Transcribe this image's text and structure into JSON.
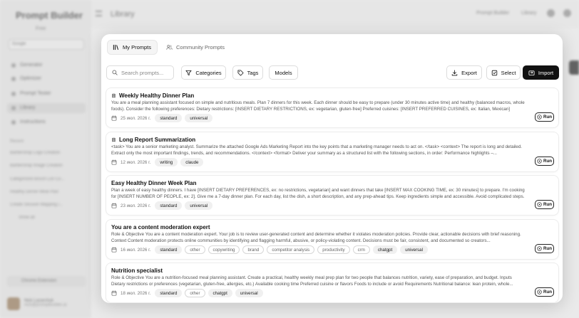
{
  "background": {
    "brand": "Prompt Builder",
    "plan": "Free",
    "workspace_select": "Google",
    "nav": [
      {
        "label": "Generator"
      },
      {
        "label": "Optimizer"
      },
      {
        "label": "Prompt Tester"
      },
      {
        "label": "Library"
      },
      {
        "label": "Instructions"
      }
    ],
    "recent_heading": "Recent",
    "recent": [
      "Barbershop Logo Creation",
      "Barbershop Image Creation",
      "Categorized Bosch List Co...",
      "Healthy Dinner Meal Plan",
      "Create Session Mapping i..."
    ],
    "recent_more": "Show all",
    "extension": "Chrome Extension",
    "user_name": "Nick Lazarchuk",
    "user_email": "nick@promptbuilder.ai",
    "page_title": "Library",
    "top_links": [
      "Prompt Builder",
      "Library"
    ]
  },
  "modal": {
    "tabs": [
      {
        "label": "My Prompts",
        "icon": "library-icon",
        "active": true
      },
      {
        "label": "Community Prompts",
        "icon": "users-icon",
        "active": false
      }
    ],
    "toolbar": {
      "search_placeholder": "Search prompts...",
      "categories": "Categories",
      "tags": "Tags",
      "models": "Models",
      "export": "Export",
      "select": "Select",
      "import": "Import"
    },
    "run_label": "Run",
    "prompts": [
      {
        "title": "Weekly Healthy Dinner Plan",
        "has_icon": true,
        "description": "You are a meal planning assistant focused on simple and nutritious meals. Plan 7 dinners for this week. Each dinner should be easy to prepare (under 30 minutes active time) and healthy (balanced macros, whole foods). Consider the following preferences: Dietary restrictions: [INSERT DIETARY RESTRICTIONS, ex: vegetarian, gluten-free] Preferred cuisines: [INSERT PREFERRED CUISINES, ex: Italian, Mexican] Number...",
        "date": "25 июл. 2026 г.",
        "tags": [
          {
            "text": "standard",
            "style": "fill"
          },
          {
            "text": "universal",
            "style": "fill"
          }
        ]
      },
      {
        "title": "Long Report Summarization",
        "has_icon": true,
        "description": "<task> You are a senior marketing analyst. Summarize the attached Google Ads Marketing Report into the key points that a marketing manager needs to act on. </task> <context> The report is long and detailed. Extract only the most important findings, trends, and recommendations. </context> <format> Deliver your summary as a structured list with the following sections, in order: Performance highlights –...",
        "date": "12 июл. 2026 г.",
        "tags": [
          {
            "text": "writing",
            "style": "fill"
          },
          {
            "text": "claude",
            "style": "fill"
          }
        ]
      },
      {
        "title": "Easy Healthy Dinner Week Plan",
        "has_icon": false,
        "description": "Plan a week of easy healthy dinners. I have [INSERT DIETARY PREFERENCES, ex: no restrictions, vegetarian] and want dinners that take [INSERT MAX COOKING TIME, ex: 30 minutes] to prepare. I'm cooking for [INSERT NUMBER OF PEOPLE, ex: 2]. Give me a 7-day dinner plan. For each day, list the dish, a short description, and any prep-ahead tips. Keep ingredients simple and accessible. Avoid complicated steps.",
        "date": "23 июл. 2026 г.",
        "tags": [
          {
            "text": "standard",
            "style": "fill"
          },
          {
            "text": "universal",
            "style": "fill"
          }
        ]
      },
      {
        "title": "You are a content moderation expert",
        "has_icon": false,
        "description": "Role & Objective You are a content moderation expert. Your job is to review user-generated content and determine whether it violates moderation policies. Provide clear, actionable decisions with brief reasoning. Context Content moderation protects online communities by identifying and flagging harmful, abusive, or policy-violating content. Decisions must be fair, consistent, and documented so creators...",
        "date": "16 июл. 2026 г.",
        "tags": [
          {
            "text": "standard",
            "style": "fill"
          },
          {
            "text": "other",
            "style": "outline"
          },
          {
            "text": "copywriting",
            "style": "outline"
          },
          {
            "text": "brand",
            "style": "outline"
          },
          {
            "text": "competitor analysis",
            "style": "outline"
          },
          {
            "text": "productivity",
            "style": "outline"
          },
          {
            "text": "crm",
            "style": "outline"
          },
          {
            "text": "chatgpt",
            "style": "fill"
          },
          {
            "text": "universal",
            "style": "fill"
          }
        ]
      },
      {
        "title": "Nutrition specialist",
        "has_icon": false,
        "description": "Role & Objective You are a nutrition-focused meal planning assistant. Create a practical, healthy weekly meal prep plan for two people that balances nutrition, variety, ease of preparation, and budget. Inputs Dietary restrictions or preferences (vegetarian, gluten-free, allergies, etc.) Available cooking time Preferred cuisine or flavors Foods to include or avoid Requirements Nutritional balance: lean protein, whole...",
        "date": "18 июл. 2026 г.",
        "tags": [
          {
            "text": "standard",
            "style": "fill"
          },
          {
            "text": "other",
            "style": "outline"
          },
          {
            "text": "chatgpt",
            "style": "fill"
          },
          {
            "text": "universal",
            "style": "fill"
          }
        ]
      }
    ]
  }
}
